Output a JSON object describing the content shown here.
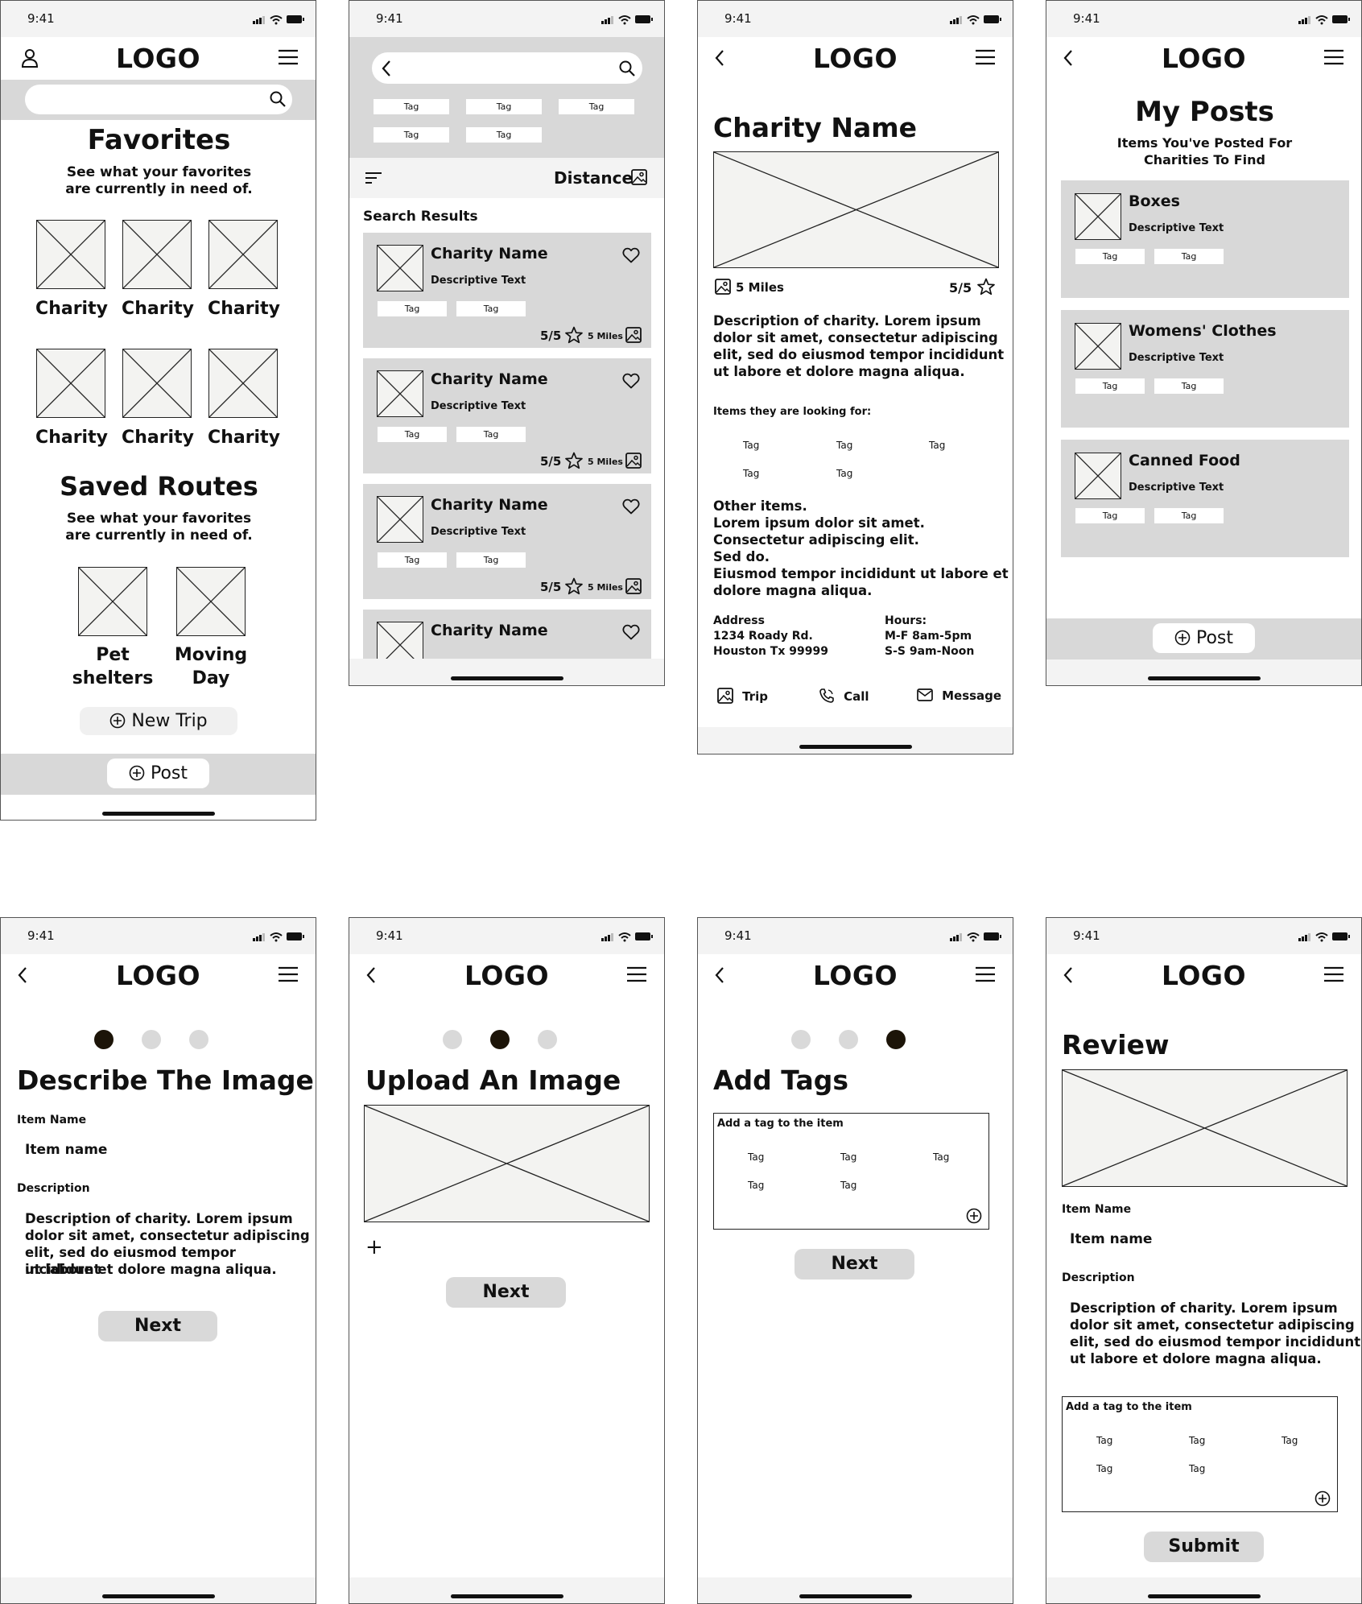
{
  "status_time": "9:41",
  "logo": "LOGO",
  "tag": "Tag",
  "s1": {
    "favorites_title": "Favorites",
    "favorites_sub_1": "See what your favorites",
    "favorites_sub_2": "are currently in need of.",
    "charity_label": "Charity",
    "routes_title": "Saved Routes",
    "routes_sub_1": "See what your favorites",
    "routes_sub_2": "are currently in need of.",
    "route1_line1": "Pet",
    "route1_line2": "shelters",
    "route2_line1": "Moving",
    "route2_line2": "Day",
    "new_trip": "New Trip",
    "post": "Post"
  },
  "s2": {
    "sort_label": "Distance",
    "results_title": "Search Results",
    "card_title": "Charity Name",
    "card_desc": "Descriptive Text",
    "rating": "5/5",
    "distance": "5 Miles"
  },
  "s3": {
    "title": "Charity Name",
    "distance": "5 Miles",
    "rating": "5/5",
    "description": [
      "Description of charity. Lorem ipsum",
      "dolor sit amet, consectetur adipiscing",
      "elit, sed do eiusmod tempor incididunt",
      "ut labore et dolore magna aliqua."
    ],
    "looking_for": "Items they are looking for:",
    "other": [
      "Other items.",
      "Lorem ipsum dolor sit amet.",
      "Consectetur adipiscing elit.",
      "Sed do.",
      "Eiusmod tempor incididunt ut labore et",
      "dolore magna aliqua."
    ],
    "address_label": "Address",
    "address_1": "1234 Roady Rd.",
    "address_2": "Houston Tx 99999",
    "hours_label": "Hours:",
    "hours_1": "M-F 8am-5pm",
    "hours_2": "S-S 9am-Noon",
    "trip": "Trip",
    "call": "Call",
    "message": "Message"
  },
  "s4": {
    "title": "My Posts",
    "sub_1": "Items You've Posted For",
    "sub_2": "Charities To Find",
    "posts": [
      "Boxes",
      "Womens' Clothes",
      "Canned Food"
    ],
    "desc": "Descriptive Text",
    "post": "Post"
  },
  "s5": {
    "title": "Describe The Image",
    "item_label": "Item Name",
    "item_value": "Item name",
    "desc_label": "Description",
    "desc_lines": [
      "Description of charity. Lorem ipsum",
      "dolor sit amet, consectetur adipiscing",
      "elit, sed do eiusmod tempor incididunt",
      "ut labore et dolore magna aliqua."
    ],
    "next": "Next"
  },
  "s6": {
    "title": "Upload An Image",
    "plus": "+",
    "next": "Next"
  },
  "s7": {
    "title": "Add Tags",
    "box_label": "Add a tag to the item",
    "next": "Next"
  },
  "s8": {
    "title": "Review",
    "item_label": "Item Name",
    "item_value": "Item name",
    "desc_label": "Description",
    "desc_lines": [
      "Description of charity. Lorem ipsum",
      "dolor sit amet, consectetur adipiscing",
      "elit, sed do eiusmod tempor incididunt",
      "ut labore et dolore magna aliqua."
    ],
    "box_label": "Add a tag to the item",
    "submit": "Submit"
  }
}
